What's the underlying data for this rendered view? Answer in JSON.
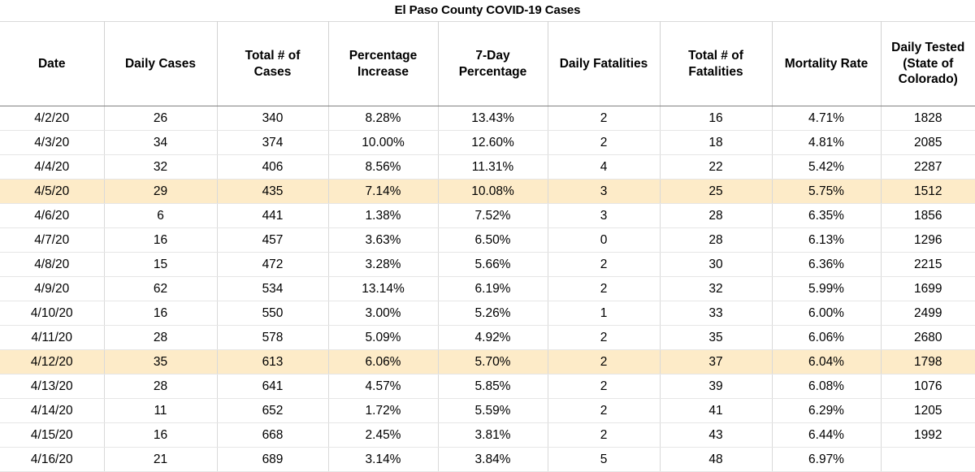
{
  "title": "El Paso County COVID-19 Cases",
  "table": {
    "columns": [
      {
        "key": "date",
        "label": "Date"
      },
      {
        "key": "daily",
        "label": "Daily Cases"
      },
      {
        "key": "total",
        "label": "Total # of Cases"
      },
      {
        "key": "pct",
        "label": "Percentage Increase"
      },
      {
        "key": "sevenday",
        "label": "7-Day Percentage"
      },
      {
        "key": "dfat",
        "label": "Daily Fatalities"
      },
      {
        "key": "tfat",
        "label": "Total # of Fatalities"
      },
      {
        "key": "mort",
        "label": "Mortality Rate"
      },
      {
        "key": "tested",
        "label": "Daily Tested (State of Colorado)"
      }
    ],
    "column_label_lines": [
      [
        "Date"
      ],
      [
        "Daily Cases"
      ],
      [
        "Total # of",
        "Cases"
      ],
      [
        "Percentage",
        "Increase"
      ],
      [
        "7-Day",
        "Percentage"
      ],
      [
        "Daily Fatalities"
      ],
      [
        "Total # of",
        "Fatalities"
      ],
      [
        "Mortality Rate"
      ],
      [
        "Daily Tested",
        "(State of",
        "Colorado)"
      ]
    ],
    "highlight_color": "#fdebc8",
    "tested_blue_color": "#3a6eb5",
    "rows": [
      {
        "date": "4/2/20",
        "daily": "26",
        "total": "340",
        "pct": "8.28%",
        "sevenday": "13.43%",
        "dfat": "2",
        "tfat": "16",
        "mort": "4.71%",
        "tested": "1828",
        "tested_blue": true,
        "highlight": false
      },
      {
        "date": "4/3/20",
        "daily": "34",
        "total": "374",
        "pct": "10.00%",
        "sevenday": "12.60%",
        "dfat": "2",
        "tfat": "18",
        "mort": "4.81%",
        "tested": "2085",
        "tested_blue": true,
        "highlight": false
      },
      {
        "date": "4/4/20",
        "daily": "32",
        "total": "406",
        "pct": "8.56%",
        "sevenday": "11.31%",
        "dfat": "4",
        "tfat": "22",
        "mort": "5.42%",
        "tested": "2287",
        "tested_blue": true,
        "highlight": false
      },
      {
        "date": "4/5/20",
        "daily": "29",
        "total": "435",
        "pct": "7.14%",
        "sevenday": "10.08%",
        "dfat": "3",
        "tfat": "25",
        "mort": "5.75%",
        "tested": "1512",
        "tested_blue": true,
        "highlight": true
      },
      {
        "date": "4/6/20",
        "daily": "6",
        "total": "441",
        "pct": "1.38%",
        "sevenday": "7.52%",
        "dfat": "3",
        "tfat": "28",
        "mort": "6.35%",
        "tested": "1856",
        "tested_blue": false,
        "highlight": false
      },
      {
        "date": "4/7/20",
        "daily": "16",
        "total": "457",
        "pct": "3.63%",
        "sevenday": "6.50%",
        "dfat": "0",
        "tfat": "28",
        "mort": "6.13%",
        "tested": "1296",
        "tested_blue": false,
        "highlight": false
      },
      {
        "date": "4/8/20",
        "daily": "15",
        "total": "472",
        "pct": "3.28%",
        "sevenday": "5.66%",
        "dfat": "2",
        "tfat": "30",
        "mort": "6.36%",
        "tested": "2215",
        "tested_blue": false,
        "highlight": false
      },
      {
        "date": "4/9/20",
        "daily": "62",
        "total": "534",
        "pct": "13.14%",
        "sevenday": "6.19%",
        "dfat": "2",
        "tfat": "32",
        "mort": "5.99%",
        "tested": "1699",
        "tested_blue": false,
        "highlight": false
      },
      {
        "date": "4/10/20",
        "daily": "16",
        "total": "550",
        "pct": "3.00%",
        "sevenday": "5.26%",
        "dfat": "1",
        "tfat": "33",
        "mort": "6.00%",
        "tested": "2499",
        "tested_blue": false,
        "highlight": false
      },
      {
        "date": "4/11/20",
        "daily": "28",
        "total": "578",
        "pct": "5.09%",
        "sevenday": "4.92%",
        "dfat": "2",
        "tfat": "35",
        "mort": "6.06%",
        "tested": "2680",
        "tested_blue": false,
        "highlight": false
      },
      {
        "date": "4/12/20",
        "daily": "35",
        "total": "613",
        "pct": "6.06%",
        "sevenday": "5.70%",
        "dfat": "2",
        "tfat": "37",
        "mort": "6.04%",
        "tested": "1798",
        "tested_blue": false,
        "highlight": true
      },
      {
        "date": "4/13/20",
        "daily": "28",
        "total": "641",
        "pct": "4.57%",
        "sevenday": "5.85%",
        "dfat": "2",
        "tfat": "39",
        "mort": "6.08%",
        "tested": "1076",
        "tested_blue": false,
        "highlight": false
      },
      {
        "date": "4/14/20",
        "daily": "11",
        "total": "652",
        "pct": "1.72%",
        "sevenday": "5.59%",
        "dfat": "2",
        "tfat": "41",
        "mort": "6.29%",
        "tested": "1205",
        "tested_blue": false,
        "highlight": false
      },
      {
        "date": "4/15/20",
        "daily": "16",
        "total": "668",
        "pct": "2.45%",
        "sevenday": "3.81%",
        "dfat": "2",
        "tfat": "43",
        "mort": "6.44%",
        "tested": "1992",
        "tested_blue": false,
        "highlight": false
      },
      {
        "date": "4/16/20",
        "daily": "21",
        "total": "689",
        "pct": "3.14%",
        "sevenday": "3.84%",
        "dfat": "5",
        "tfat": "48",
        "mort": "6.97%",
        "tested": "",
        "tested_blue": false,
        "highlight": false
      }
    ]
  },
  "chart_data": {
    "type": "table",
    "title": "El Paso County COVID-19 Cases",
    "columns": [
      "Date",
      "Daily Cases",
      "Total # of Cases",
      "Percentage Increase",
      "7-Day Percentage",
      "Daily Fatalities",
      "Total # of Fatalities",
      "Mortality Rate",
      "Daily Tested (State of Colorado)"
    ],
    "rows": [
      [
        "4/2/20",
        26,
        340,
        "8.28%",
        "13.43%",
        2,
        16,
        "4.71%",
        1828
      ],
      [
        "4/3/20",
        34,
        374,
        "10.00%",
        "12.60%",
        2,
        18,
        "4.81%",
        2085
      ],
      [
        "4/4/20",
        32,
        406,
        "8.56%",
        "11.31%",
        4,
        22,
        "5.42%",
        2287
      ],
      [
        "4/5/20",
        29,
        435,
        "7.14%",
        "10.08%",
        3,
        25,
        "5.75%",
        1512
      ],
      [
        "4/6/20",
        6,
        441,
        "1.38%",
        "7.52%",
        3,
        28,
        "6.35%",
        1856
      ],
      [
        "4/7/20",
        16,
        457,
        "3.63%",
        "6.50%",
        0,
        28,
        "6.13%",
        1296
      ],
      [
        "4/8/20",
        15,
        472,
        "3.28%",
        "5.66%",
        2,
        30,
        "6.36%",
        2215
      ],
      [
        "4/9/20",
        62,
        534,
        "13.14%",
        "6.19%",
        2,
        32,
        "5.99%",
        1699
      ],
      [
        "4/10/20",
        16,
        550,
        "3.00%",
        "5.26%",
        1,
        33,
        "6.00%",
        2499
      ],
      [
        "4/11/20",
        28,
        578,
        "5.09%",
        "4.92%",
        2,
        35,
        "6.06%",
        2680
      ],
      [
        "4/12/20",
        35,
        613,
        "6.06%",
        "5.70%",
        2,
        37,
        "6.04%",
        1798
      ],
      [
        "4/13/20",
        28,
        641,
        "4.57%",
        "5.85%",
        2,
        39,
        "6.08%",
        1076
      ],
      [
        "4/14/20",
        11,
        652,
        "1.72%",
        "5.59%",
        2,
        41,
        "6.29%",
        1205
      ],
      [
        "4/15/20",
        16,
        668,
        "2.45%",
        "3.81%",
        2,
        43,
        "6.44%",
        1992
      ],
      [
        "4/16/20",
        21,
        689,
        "3.14%",
        "3.84%",
        5,
        48,
        "6.97%",
        null
      ]
    ]
  }
}
